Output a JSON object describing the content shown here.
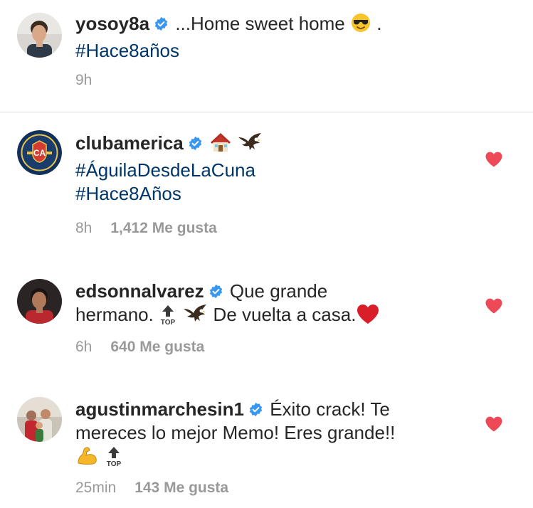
{
  "post": {
    "username": "yosoy8a",
    "caption": "...Home sweet home",
    "caption_end": ".",
    "hashtag": "#Hace8años",
    "time": "9h"
  },
  "comments": [
    {
      "username": "clubamerica",
      "hashtag_1": "#ÁguilaDesdeLaCuna",
      "hashtag_2": "#Hace8Años",
      "time": "8h",
      "likes": "1,412 Me gusta",
      "liked": true
    },
    {
      "username": "edsonnalvarez",
      "text_1": "Que grande",
      "text_2": "hermano.",
      "text_3": "De vuelta a casa.",
      "top_label": "TOP",
      "time": "6h",
      "likes": "640 Me gusta",
      "liked": true
    },
    {
      "username": "agustinmarchesin1",
      "text_1": "Éxito crack! Te",
      "text_2": "mereces lo mejor Memo! Eres grande!!",
      "top_label": "TOP",
      "time": "25min",
      "likes": "143 Me gusta",
      "liked": true
    }
  ],
  "colors": {
    "hashtag": "#003569",
    "verified": "#3897f0",
    "heart": "#ed4956",
    "meta": "#999999"
  }
}
